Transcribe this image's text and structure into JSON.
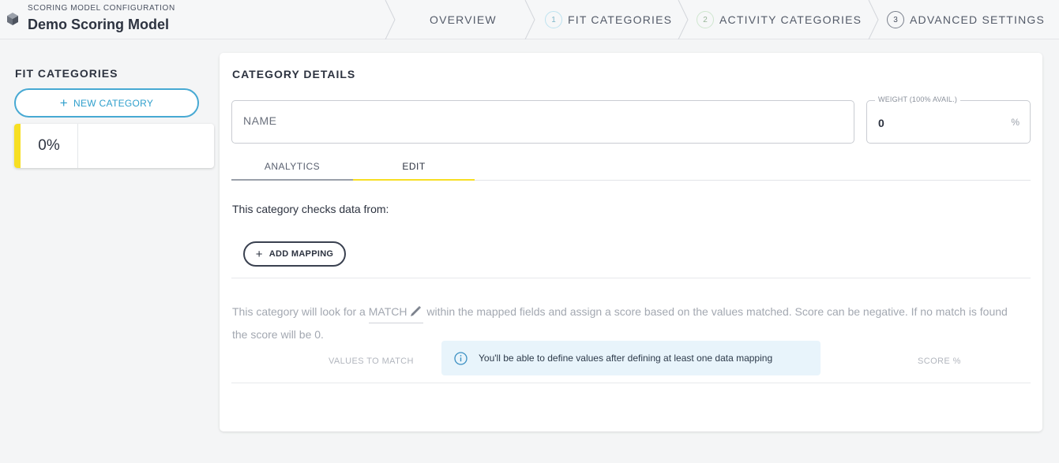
{
  "header": {
    "kicker": "SCORING MODEL CONFIGURATION",
    "title": "Demo Scoring Model",
    "icon": "cube-icon",
    "steps": [
      {
        "number": "",
        "label": "OVERVIEW"
      },
      {
        "number": "1",
        "label": "FIT CATEGORIES"
      },
      {
        "number": "2",
        "label": "ACTIVITY CATEGORIES"
      },
      {
        "number": "3",
        "label": "ADVANCED SETTINGS"
      }
    ]
  },
  "sidebar": {
    "title": "FIT CATEGORIES",
    "new_category_label": "NEW CATEGORY",
    "categories": [
      {
        "percent": "0%",
        "color": "#f7df23"
      }
    ]
  },
  "details": {
    "title": "CATEGORY DETAILS",
    "name_placeholder": "NAME",
    "weight_label": "WEIGHT (100% AVAIL.)",
    "weight_value": "0",
    "weight_unit": "%",
    "tabs": [
      {
        "label": "ANALYTICS"
      },
      {
        "label": "EDIT"
      }
    ],
    "active_tab": "EDIT",
    "checks_text": "This category checks data from:",
    "add_mapping_label": "ADD MAPPING",
    "description_before": "This category will look for a ",
    "match_word": "MATCH",
    "description_after": " within the mapped fields and assign a score based on the values matched. Score can be negative. If no match is found the score will be 0.",
    "col_values": "VALUES TO MATCH",
    "col_score": "SCORE %",
    "info_text": "You'll be able to define values after defining at least one data mapping"
  },
  "colors": {
    "accent_blue": "#47a9d3",
    "accent_yellow": "#f7df23",
    "info_background": "#e8f4fb"
  }
}
